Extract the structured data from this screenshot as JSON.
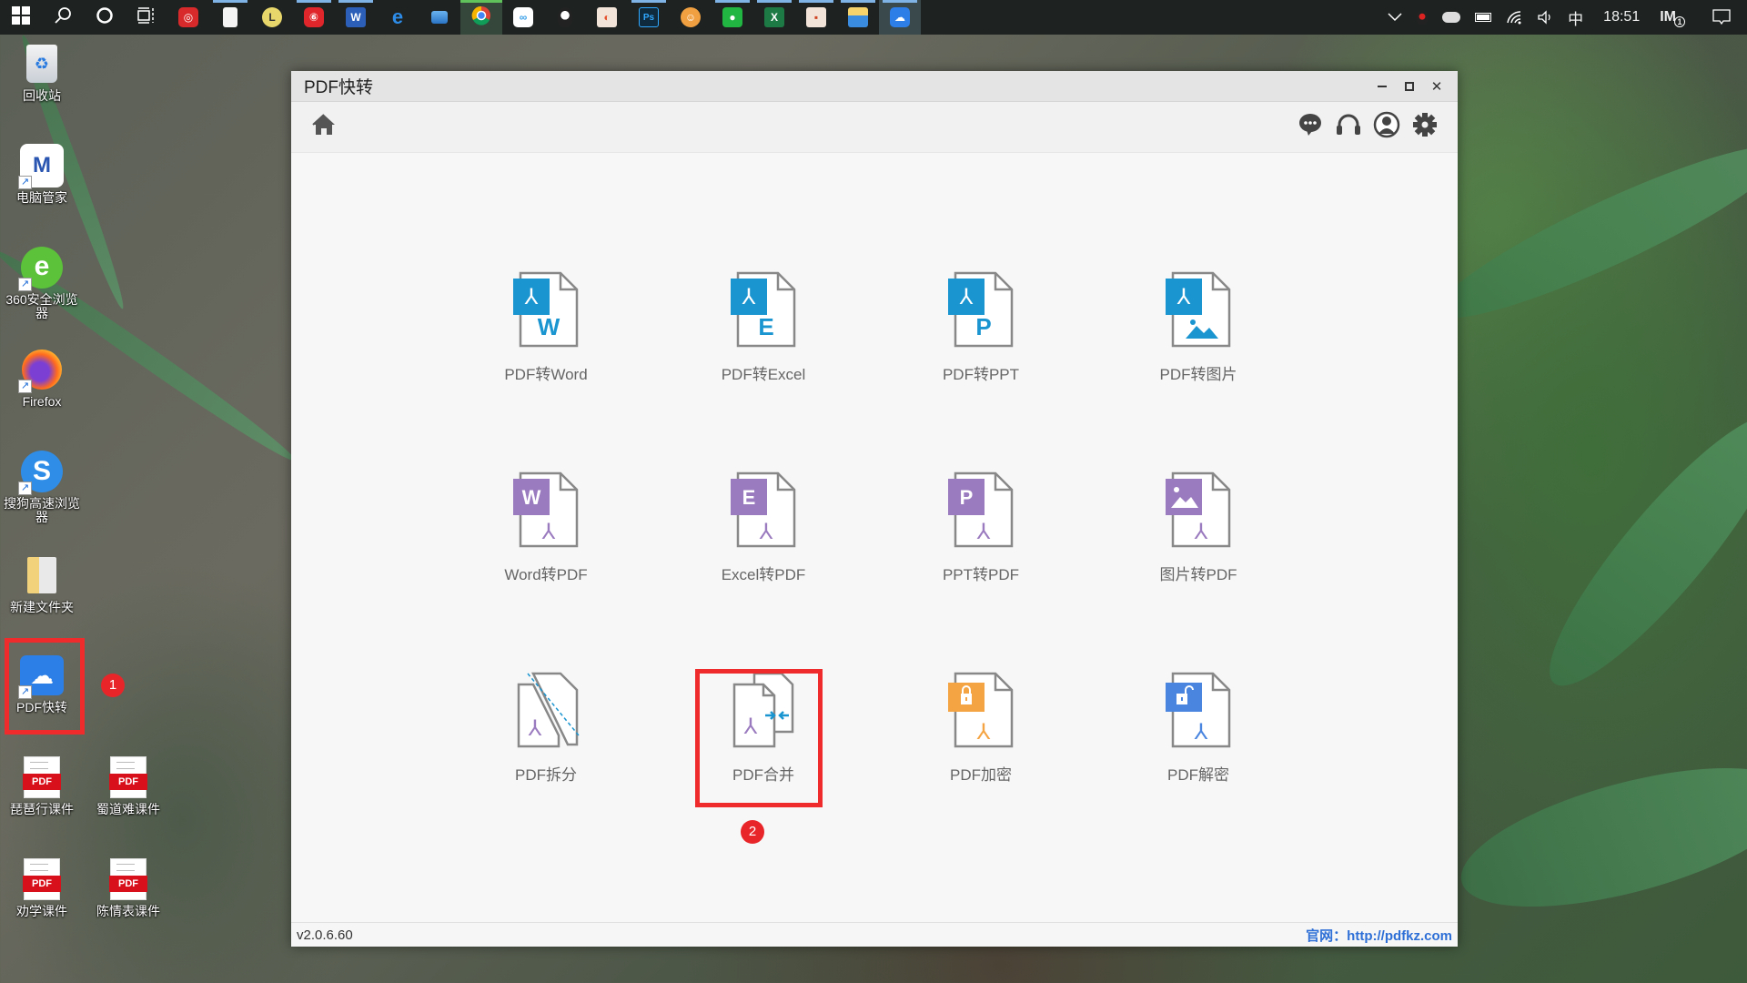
{
  "taskbar": {
    "items": [
      {
        "name": "start",
        "icon": "windows-icon"
      },
      {
        "name": "search",
        "icon": "search-icon"
      },
      {
        "name": "cortana",
        "icon": "cortana-icon"
      },
      {
        "name": "task-view",
        "icon": "task-view-icon"
      },
      {
        "name": "app-red",
        "icon": "app-red-icon"
      },
      {
        "name": "file",
        "icon": "blank-file-icon",
        "running": true
      },
      {
        "name": "app-l",
        "icon": "app-l-icon"
      },
      {
        "name": "netease-music",
        "icon": "netease-music-icon",
        "running": true
      },
      {
        "name": "word",
        "icon": "word-icon",
        "running": true
      },
      {
        "name": "edge",
        "icon": "edge-icon"
      },
      {
        "name": "computer",
        "icon": "computer-icon"
      },
      {
        "name": "chrome",
        "icon": "chrome-icon"
      },
      {
        "name": "baidu-netdisk",
        "icon": "baidu-netdisk-icon"
      },
      {
        "name": "qq",
        "icon": "qq-icon"
      },
      {
        "name": "wps-ppt",
        "icon": "wps-ppt-icon"
      },
      {
        "name": "photoshop",
        "icon": "photoshop-icon",
        "running": true
      },
      {
        "name": "game",
        "icon": "game-icon"
      },
      {
        "name": "wechat",
        "icon": "wechat-icon",
        "running": true
      },
      {
        "name": "excel",
        "icon": "excel-icon",
        "running": true
      },
      {
        "name": "ppt",
        "icon": "ppt-icon",
        "running": true
      },
      {
        "name": "explorer",
        "icon": "folder-icon",
        "running": true
      },
      {
        "name": "pdf-kuaizhuan",
        "icon": "pdf-kuaizhuan-icon",
        "running": true
      }
    ],
    "tray": {
      "ime": "中",
      "time": "18:51",
      "notification_count": "1"
    }
  },
  "desktop": {
    "icons": [
      {
        "label": "回收站",
        "icon": "recycle-bin-icon"
      },
      {
        "label": "电脑管家",
        "icon": "pc-manager-icon"
      },
      {
        "label": "360安全浏览器",
        "icon": "360-browser-icon"
      },
      {
        "label": "Firefox",
        "icon": "firefox-icon"
      },
      {
        "label": "搜狗高速浏览器",
        "icon": "sogou-browser-icon"
      },
      {
        "label": "新建文件夹",
        "icon": "folder-icon"
      },
      {
        "label": "PDF快转",
        "icon": "pdf-kuaizhuan-icon"
      },
      {
        "label": "琵琶行课件",
        "icon": "pdf-file-icon"
      },
      {
        "label": "蜀道难课件",
        "icon": "pdf-file-icon"
      },
      {
        "label": "劝学课件",
        "icon": "pdf-file-icon"
      },
      {
        "label": "陈情表课件",
        "icon": "pdf-file-icon"
      }
    ],
    "pdf_badge": "PDF",
    "annotations": [
      "1",
      "2"
    ]
  },
  "window": {
    "title": "PDF快转",
    "controls": {
      "minimize": "–",
      "maximize": "□",
      "close": "✕"
    },
    "toolbar": {
      "left": "home-icon",
      "right": [
        "chat-icon",
        "headset-icon",
        "user-icon",
        "gear-icon"
      ]
    },
    "tools": [
      {
        "label": "PDF转Word",
        "badge": "W",
        "type": "pdf2x"
      },
      {
        "label": "PDF转Excel",
        "badge": "E",
        "type": "pdf2x"
      },
      {
        "label": "PDF转PPT",
        "badge": "P",
        "type": "pdf2x"
      },
      {
        "label": "PDF转图片",
        "badge": "img",
        "type": "pdf2x"
      },
      {
        "label": "Word转PDF",
        "badge": "W",
        "type": "x2pdf"
      },
      {
        "label": "Excel转PDF",
        "badge": "E",
        "type": "x2pdf"
      },
      {
        "label": "PPT转PDF",
        "badge": "P",
        "type": "x2pdf"
      },
      {
        "label": "图片转PDF",
        "badge": "img",
        "type": "x2pdf"
      },
      {
        "label": "PDF拆分",
        "type": "split"
      },
      {
        "label": "PDF合并",
        "type": "merge"
      },
      {
        "label": "PDF加密",
        "type": "encrypt"
      },
      {
        "label": "PDF解密",
        "type": "decrypt"
      }
    ],
    "status": {
      "version": "v2.0.6.60",
      "site_label": "官网：",
      "site_url": "http://pdfkz.com"
    },
    "colors": {
      "blue": "#1b95d0",
      "purple": "#9b7bbf",
      "orange": "#f5a443",
      "decrypt_blue": "#4a86e0",
      "annotation_red": "#ef2b2b"
    }
  }
}
